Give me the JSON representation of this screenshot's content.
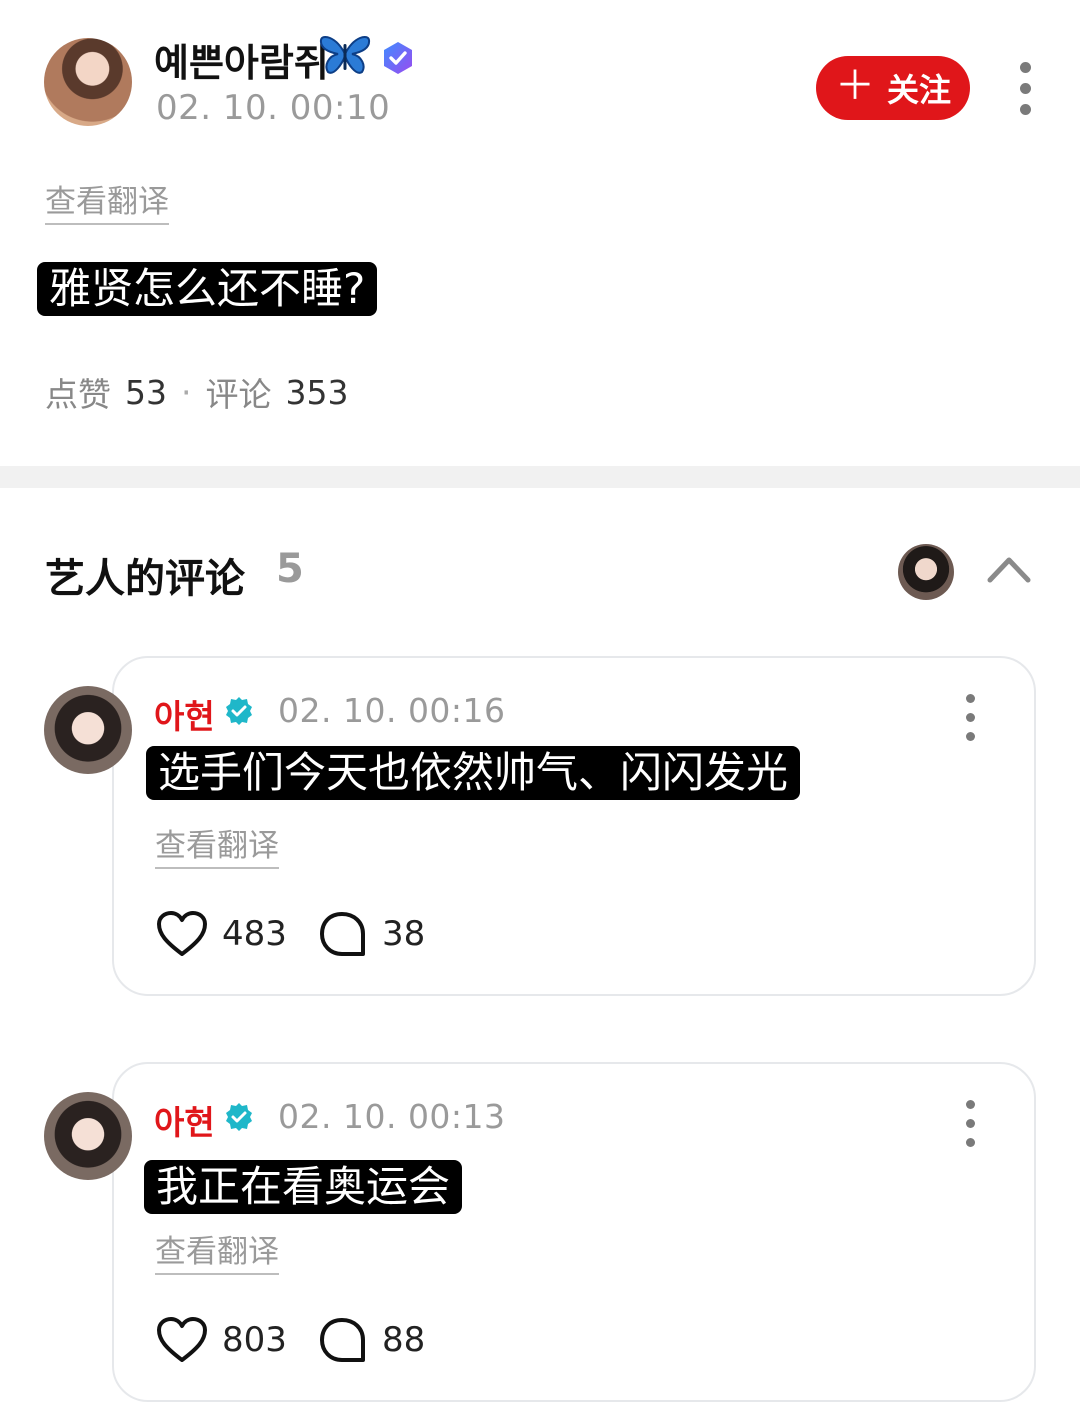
{
  "post": {
    "author": "예쁜아람쥐",
    "time": "02. 10. 00:10",
    "follow_label": "关注",
    "follow_plus": "＋",
    "see_translation": "查看翻译",
    "text": "雅贤怎么还不睡?",
    "likes_label": "点赞",
    "likes_count": "53",
    "dot": "·",
    "comments_label": "评论",
    "comments_count": "353"
  },
  "artist_comments": {
    "title": "艺人的评论",
    "count": "5",
    "items": [
      {
        "author": "아현",
        "time": "02. 10. 00:16",
        "text": "选手们今天也依然帅气、闪闪发光",
        "see_translation": "查看翻译",
        "likes": "483",
        "replies": "38"
      },
      {
        "author": "아현",
        "time": "02. 10. 00:13",
        "text": "我正在看奥运会",
        "see_translation": "查看翻译",
        "likes": "803",
        "replies": "88"
      }
    ]
  },
  "colors": {
    "accent_red": "#e0161a",
    "verify_teal": "#1fb7c9",
    "verify_purple": "#6f5bf0"
  },
  "icons": [
    "butterfly-emoji",
    "verified-badge-icon",
    "more-vertical-icon",
    "chevron-up-icon",
    "heart-icon",
    "comment-bubble-icon"
  ]
}
